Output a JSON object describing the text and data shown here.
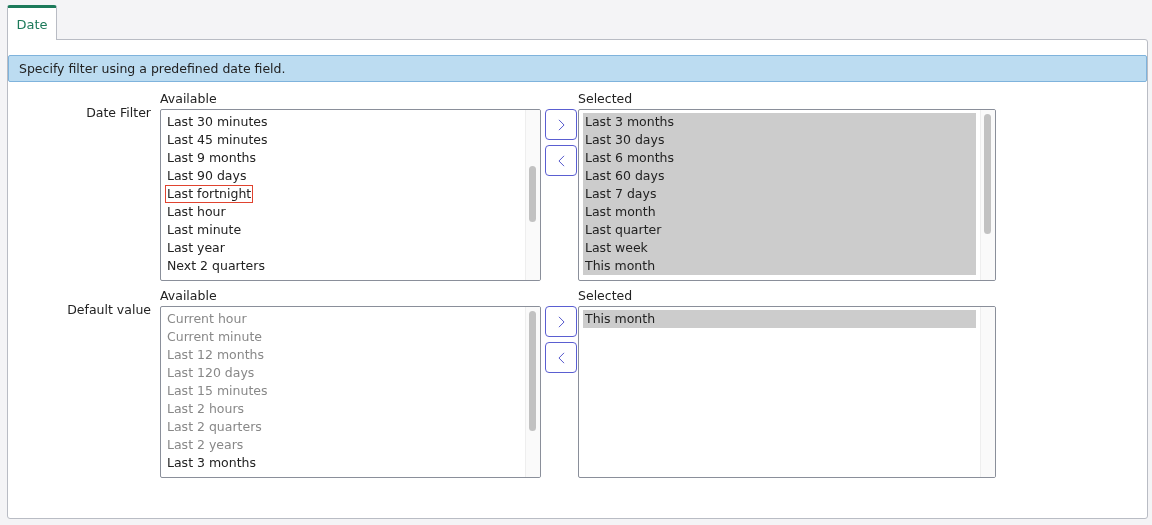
{
  "tab": {
    "label": "Date",
    "selected": true
  },
  "info": "Specify filter using a predefined date field.",
  "fields": [
    {
      "label": "Date Filter",
      "available": {
        "header": "Available",
        "items": [
          {
            "text": "Last 30 minutes",
            "selected": false,
            "disabled": false,
            "focused": false
          },
          {
            "text": "Last 45 minutes",
            "selected": false,
            "disabled": false,
            "focused": false
          },
          {
            "text": "Last 9 months",
            "selected": false,
            "disabled": false,
            "focused": false
          },
          {
            "text": "Last 90 days",
            "selected": false,
            "disabled": false,
            "focused": false
          },
          {
            "text": "Last fortnight",
            "selected": false,
            "disabled": false,
            "focused": true
          },
          {
            "text": "Last hour",
            "selected": false,
            "disabled": false,
            "focused": false
          },
          {
            "text": "Last minute",
            "selected": false,
            "disabled": false,
            "focused": false
          },
          {
            "text": "Last year",
            "selected": false,
            "disabled": false,
            "focused": false
          },
          {
            "text": "Next 2 quarters",
            "selected": false,
            "disabled": false,
            "focused": false
          }
        ]
      },
      "selected": {
        "header": "Selected",
        "items": [
          {
            "text": "Last 3 months",
            "selected": true,
            "disabled": false,
            "focused": false
          },
          {
            "text": "Last 30 days",
            "selected": true,
            "disabled": false,
            "focused": false
          },
          {
            "text": "Last 6 months",
            "selected": true,
            "disabled": false,
            "focused": false
          },
          {
            "text": "Last 60 days",
            "selected": true,
            "disabled": false,
            "focused": false
          },
          {
            "text": "Last 7 days",
            "selected": true,
            "disabled": false,
            "focused": false
          },
          {
            "text": "Last month",
            "selected": true,
            "disabled": false,
            "focused": false
          },
          {
            "text": "Last quarter",
            "selected": true,
            "disabled": false,
            "focused": false
          },
          {
            "text": "Last week",
            "selected": true,
            "disabled": false,
            "focused": false
          },
          {
            "text": "This month",
            "selected": true,
            "disabled": false,
            "focused": false
          }
        ]
      }
    },
    {
      "label": "Default value",
      "available": {
        "header": "Available",
        "items": [
          {
            "text": "Current hour",
            "selected": false,
            "disabled": true,
            "focused": false
          },
          {
            "text": "Current minute",
            "selected": false,
            "disabled": true,
            "focused": false
          },
          {
            "text": "Last 12 months",
            "selected": false,
            "disabled": true,
            "focused": false
          },
          {
            "text": "Last 120 days",
            "selected": false,
            "disabled": true,
            "focused": false
          },
          {
            "text": "Last 15 minutes",
            "selected": false,
            "disabled": true,
            "focused": false
          },
          {
            "text": "Last 2 hours",
            "selected": false,
            "disabled": true,
            "focused": false
          },
          {
            "text": "Last 2 quarters",
            "selected": false,
            "disabled": true,
            "focused": false
          },
          {
            "text": "Last 2 years",
            "selected": false,
            "disabled": true,
            "focused": false
          },
          {
            "text": "Last 3 months",
            "selected": false,
            "disabled": false,
            "focused": false
          }
        ]
      },
      "selected": {
        "header": "Selected",
        "items": [
          {
            "text": "This month",
            "selected": true,
            "disabled": false,
            "focused": false
          }
        ]
      }
    }
  ]
}
